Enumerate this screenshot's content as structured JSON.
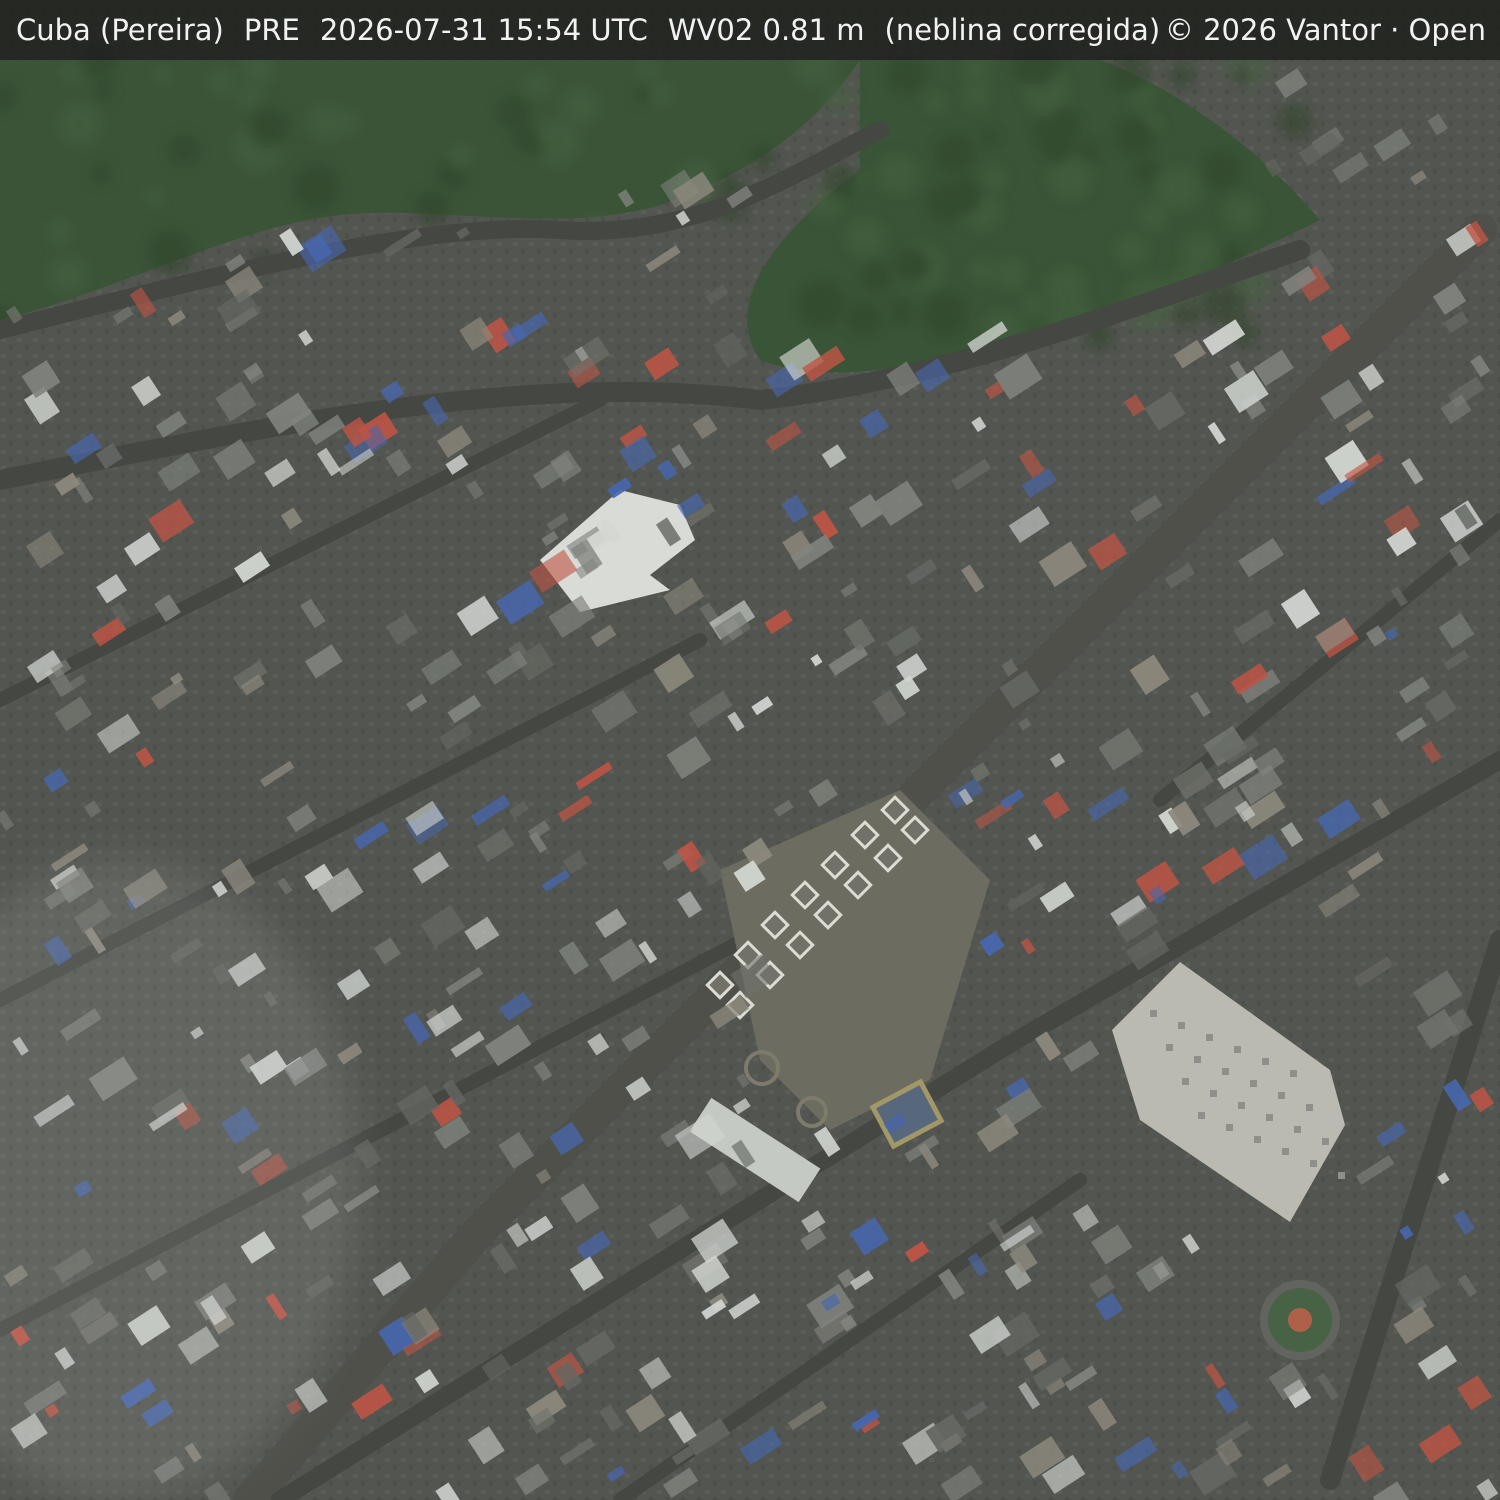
{
  "caption": {
    "location": "Cuba (Pereira)",
    "code": "PRE",
    "datetime": "2026-07-31 15:54 UTC",
    "sensor": "WV02 0.81 m",
    "processing": "(neblina corregida)",
    "credit": "© 2026 Vantor · Open"
  },
  "palette": {
    "urban_base": "#4a4c47",
    "forest": "#2f4a2c",
    "road": "#3d3f3b",
    "plaza": "#6b6a5e",
    "roof_white": "#d9dcd8",
    "roof_red": "#c24a3a",
    "roof_blue": "#3d5fb0",
    "roof_grey": "#7d7f7a",
    "market_roof": "#bdbbb3"
  }
}
